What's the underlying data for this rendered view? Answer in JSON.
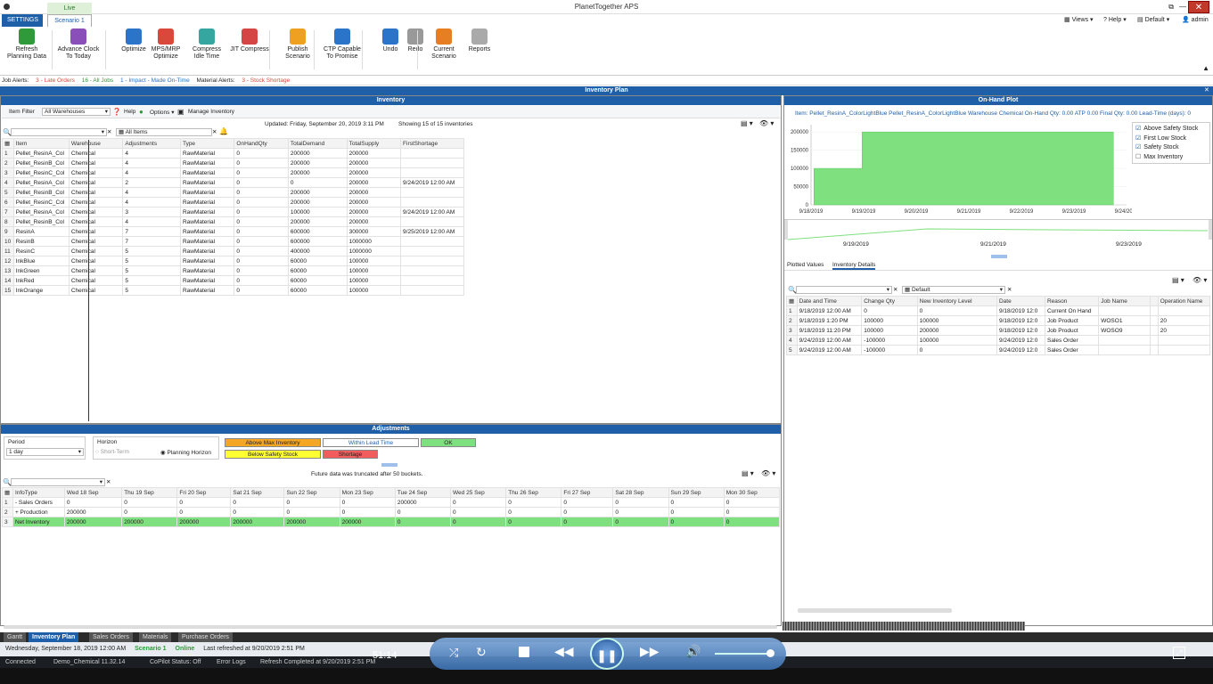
{
  "app": {
    "title": "PlanetTogether APS"
  },
  "tabs": {
    "settings": "SETTINGS",
    "live": "Live",
    "scenario": "Scenario 1"
  },
  "topright": {
    "views": "Views",
    "help": "Help",
    "def": "Default",
    "user": "admin"
  },
  "ribbon": [
    {
      "name": "refresh",
      "label1": "Refresh",
      "label2": "Planning Data",
      "color": "#2e9a3a"
    },
    {
      "name": "advance-clock",
      "label1": "Advance Clock",
      "label2": "To Today",
      "color": "#8a4fb8"
    },
    {
      "name": "optimize",
      "label1": "Optimize",
      "label2": "",
      "color": "#2a74c9"
    },
    {
      "name": "mps-mrp",
      "label1": "MPS/MRP",
      "label2": "Optimize",
      "color": "#d9483b"
    },
    {
      "name": "compress-idle",
      "label1": "Compress",
      "label2": "Idle Time",
      "color": "#35a7a0"
    },
    {
      "name": "jit-compress",
      "label1": "JIT Compress",
      "label2": "",
      "color": "#d64545"
    },
    {
      "name": "publish",
      "label1": "Publish",
      "label2": "Scenario",
      "color": "#f0a020"
    },
    {
      "name": "ctp",
      "label1": "CTP Capable",
      "label2": "To Promise",
      "color": "#2a74c9"
    },
    {
      "name": "undo",
      "label1": "Undo",
      "label2": "",
      "color": "#2a74c9"
    },
    {
      "name": "redo",
      "label1": "Redo",
      "label2": "",
      "color": "#999999"
    },
    {
      "name": "current-scenario",
      "label1": "Current",
      "label2": "Scenario",
      "color": "#e67e22"
    },
    {
      "name": "reports",
      "label1": "Reports",
      "label2": "",
      "color": "#aaaaaa"
    }
  ],
  "alerts": {
    "job_label": "Job Alerts:",
    "late": "3 - Late Orders",
    "all": "16 - All Jobs",
    "impact": "1 - Impact - Made On-Time",
    "mat_label": "Material Alerts:",
    "shortage": "3 - Stock Shortage"
  },
  "headers": {
    "inv_plan": "Inventory Plan",
    "inventory": "Inventory",
    "onhand": "On-Hand Plot",
    "adjustments": "Adjustments"
  },
  "inventory": {
    "item_filter": "Item Filter",
    "warehouses": "All Warehouses",
    "help": "Help",
    "options": "Options",
    "manage": "Manage Inventory",
    "updated": "Updated: Friday, September 20, 2019  3:11 PM",
    "showing": "Showing 15 of 15 inventories",
    "all_items": "All Items",
    "columns": [
      "Item",
      "Warehouse",
      "Adjustments",
      "Type",
      "OnHandQty",
      "TotalDemand",
      "TotalSupply",
      "FirstShortage"
    ],
    "rows": [
      [
        "1",
        "Pellet_ResinA_Col",
        "Chemical",
        "4",
        "RawMaterial",
        "0",
        "200000",
        "200000",
        ""
      ],
      [
        "2",
        "Pellet_ResinB_Col",
        "Chemical",
        "4",
        "RawMaterial",
        "0",
        "200000",
        "200000",
        ""
      ],
      [
        "3",
        "Pellet_ResinC_Col",
        "Chemical",
        "4",
        "RawMaterial",
        "0",
        "200000",
        "200000",
        ""
      ],
      [
        "4",
        "Pellet_ResinA_Col",
        "Chemical",
        "2",
        "RawMaterial",
        "0",
        "0",
        "200000",
        "9/24/2019 12:00 AM"
      ],
      [
        "5",
        "Pellet_ResinB_Col",
        "Chemical",
        "4",
        "RawMaterial",
        "0",
        "200000",
        "200000",
        ""
      ],
      [
        "6",
        "Pellet_ResinC_Col",
        "Chemical",
        "4",
        "RawMaterial",
        "0",
        "200000",
        "200000",
        ""
      ],
      [
        "7",
        "Pellet_ResinA_Col",
        "Chemical",
        "3",
        "RawMaterial",
        "0",
        "100000",
        "200000",
        "9/24/2019 12:00 AM"
      ],
      [
        "8",
        "Pellet_ResinB_Col",
        "Chemical",
        "4",
        "RawMaterial",
        "0",
        "200000",
        "200000",
        ""
      ],
      [
        "9",
        "ResinA",
        "Chemical",
        "7",
        "RawMaterial",
        "0",
        "600000",
        "300000",
        "9/25/2019 12:00 AM"
      ],
      [
        "10",
        "ResinB",
        "Chemical",
        "7",
        "RawMaterial",
        "0",
        "600000",
        "1000000",
        ""
      ],
      [
        "11",
        "ResinC",
        "Chemical",
        "5",
        "RawMaterial",
        "0",
        "400000",
        "1000000",
        ""
      ],
      [
        "12",
        "InkBlue",
        "Chemical",
        "5",
        "RawMaterial",
        "0",
        "60000",
        "100000",
        ""
      ],
      [
        "13",
        "InkGreen",
        "Chemical",
        "5",
        "RawMaterial",
        "0",
        "60000",
        "100000",
        ""
      ],
      [
        "14",
        "InkRed",
        "Chemical",
        "5",
        "RawMaterial",
        "0",
        "60000",
        "100000",
        ""
      ],
      [
        "15",
        "InkOrange",
        "Chemical",
        "5",
        "RawMaterial",
        "0",
        "60000",
        "100000",
        ""
      ]
    ]
  },
  "onhand": {
    "info": "Item: Pellet_ResinA_ColorLightBlue Pellet_ResinA_ColorLightBlue Warehouse Chemical On-Hand Qty: 0.00 ATP 0.00 Final Qty: 0.00 Lead-Time (days): 0",
    "legend": [
      {
        "label": "Above Safety Stock",
        "checked": true
      },
      {
        "label": "First Low Stock",
        "checked": true
      },
      {
        "label": "Safety Stock",
        "checked": true
      },
      {
        "label": "Max Inventory",
        "checked": false
      }
    ],
    "tabs": [
      "Plotted Values",
      "Inventory Details"
    ],
    "default": "Default",
    "columns": [
      "Date and Time",
      "Change Qty",
      "New Inventory Level",
      "Date",
      "Reason",
      "Job Name",
      "",
      "Operation Name"
    ],
    "rows": [
      [
        "1",
        "9/18/2019 12:00 AM",
        "0",
        "0",
        "9/18/2019 12:0",
        "Current On Hand",
        "",
        "",
        ""
      ],
      [
        "2",
        "9/18/2019 1:20 PM",
        "100000",
        "100000",
        "9/18/2019 12:0",
        "Job Product",
        "WOSO1",
        "",
        "20"
      ],
      [
        "3",
        "9/18/2019 11:20 PM",
        "100000",
        "200000",
        "9/18/2019 12:0",
        "Job Product",
        "WOSO9",
        "",
        "20"
      ],
      [
        "4",
        "9/24/2019 12:00 AM",
        "-100000",
        "100000",
        "9/24/2019 12:0",
        "Sales Order",
        "",
        "",
        ""
      ],
      [
        "5",
        "9/24/2019 12:00 AM",
        "-100000",
        "0",
        "9/24/2019 12:0",
        "Sales Order",
        "",
        "",
        ""
      ]
    ],
    "mini_ticks": [
      "9/19/2019",
      "9/21/2019",
      "9/23/2019"
    ]
  },
  "chart_data": {
    "type": "area",
    "x": [
      "9/18/2019",
      "9/19/2019",
      "9/20/2019",
      "9/21/2019",
      "9/22/2019",
      "9/23/2019",
      "9/24/2019"
    ],
    "step_points": [
      [
        "9/18/2019 01:20",
        100000
      ],
      [
        "9/18/2019 23:20",
        200000
      ],
      [
        "9/24/2019 00:00",
        0
      ]
    ],
    "yticks": [
      0,
      50000,
      100000,
      150000,
      200000
    ],
    "ylim": [
      0,
      220000
    ],
    "color": "#7ee07e",
    "legend_position": "right"
  },
  "adjust": {
    "period_label": "Period",
    "period_value": "1 day",
    "horizon_label": "Horizon",
    "short_term": "Short-Term",
    "planning": "Planning Horizon",
    "legend": [
      {
        "label": "Above Max Inventory",
        "color": "#f5a623"
      },
      {
        "label": "Within Lead Time",
        "color": "#ffffff"
      },
      {
        "label": "OK",
        "color": "#7ee07e"
      },
      {
        "label": "Below Safety Stock",
        "color": "#ffff33"
      },
      {
        "label": "Shortage",
        "color": "#f25c5c"
      }
    ],
    "truncated": "Future data was truncated after 50 buckets.",
    "columns": [
      "InfoType",
      "Wed 18 Sep",
      "Thu 19 Sep",
      "Fri 20 Sep",
      "Sat 21 Sep",
      "Sun 22 Sep",
      "Mon 23 Sep",
      "Tue 24 Sep",
      "Wed 25 Sep",
      "Thu 26 Sep",
      "Fri 27 Sep",
      "Sat 28 Sep",
      "Sun 29 Sep",
      "Mon 30 Sep"
    ],
    "rows": [
      [
        "1",
        "- Sales Orders",
        "0",
        "0",
        "0",
        "0",
        "0",
        "0",
        "200000",
        "0",
        "0",
        "0",
        "0",
        "0",
        "0"
      ],
      [
        "2",
        "+ Production",
        "200000",
        "0",
        "0",
        "0",
        "0",
        "0",
        "0",
        "0",
        "0",
        "0",
        "0",
        "0",
        "0"
      ],
      [
        "3",
        "Net Inventory",
        "200000",
        "200000",
        "200000",
        "200000",
        "200000",
        "200000",
        "0",
        "0",
        "0",
        "0",
        "0",
        "0",
        "0"
      ]
    ]
  },
  "bottomtabs": [
    "Gantt",
    "Inventory Plan",
    "Sales Orders",
    "Materials",
    "Purchase Orders"
  ],
  "status": {
    "date": "Wednesday, September 18, 2019 12:00 AM",
    "scenario": "Scenario 1",
    "online": "Online",
    "refreshed": "Last refreshed at 9/20/2019 2:51 PM"
  },
  "status2": {
    "connected": "Connected",
    "db": "Demo_Chemical 11.32.14",
    "copilot": "CoPilot Status: Off",
    "logs": "Error Logs",
    "refresh": "Refresh Completed at 9/20/2019 2:51 PM"
  },
  "player": {
    "time": "51:14"
  }
}
